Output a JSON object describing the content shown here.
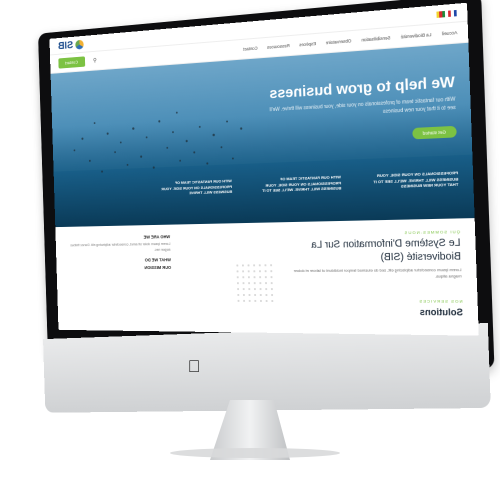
{
  "site": {
    "logo_text": "SIB",
    "topbar": {
      "lang_label": "FR"
    },
    "nav": {
      "items": [
        "Accueil",
        "La Biodiversité",
        "Sensibilisation",
        "Observatoire",
        "Espèces",
        "Ressources",
        "Contact"
      ],
      "cta_label": "Contact",
      "search_icon": "search-icon"
    },
    "hero": {
      "title": "We help to grow business",
      "subtitle": "With our fantastic team of professionals on your side, your business will thrive. We'll see to it that your new business",
      "button_label": "Get started",
      "stats": [
        "Professionals on your side. Your business will thrive. We'll see to it that your new business",
        "With our fantastic team of professionals on your side. Your business will thrive. We'll see to it",
        "With our fantastic team of professionals on your side. Your business will thrive"
      ]
    },
    "about": {
      "kicker": "QUI SOMMES-NOUS",
      "title": "Le Système D'information Sur La Biodiversité (SIB)",
      "text": "Lorem ipsum consectetur adipiscing elit, sed do eiusmod tempor incididunt ut labore et dolore magna aliqua.",
      "side_head_1": "WHO ARE WE",
      "side_text_1": "Lorem ipsum dolor sit amet, consectetur adipiscing elit. Donec finibus augue nec.",
      "side_head_2": "WHAT WE DO",
      "side_head_3": "OUR MISSION",
      "kicker_2": "NOS SERVICES",
      "solutions_title": "Solutions"
    }
  },
  "colors": {
    "accent": "#7cc243",
    "brand": "#1b4c8c",
    "sea": "#155a82"
  }
}
